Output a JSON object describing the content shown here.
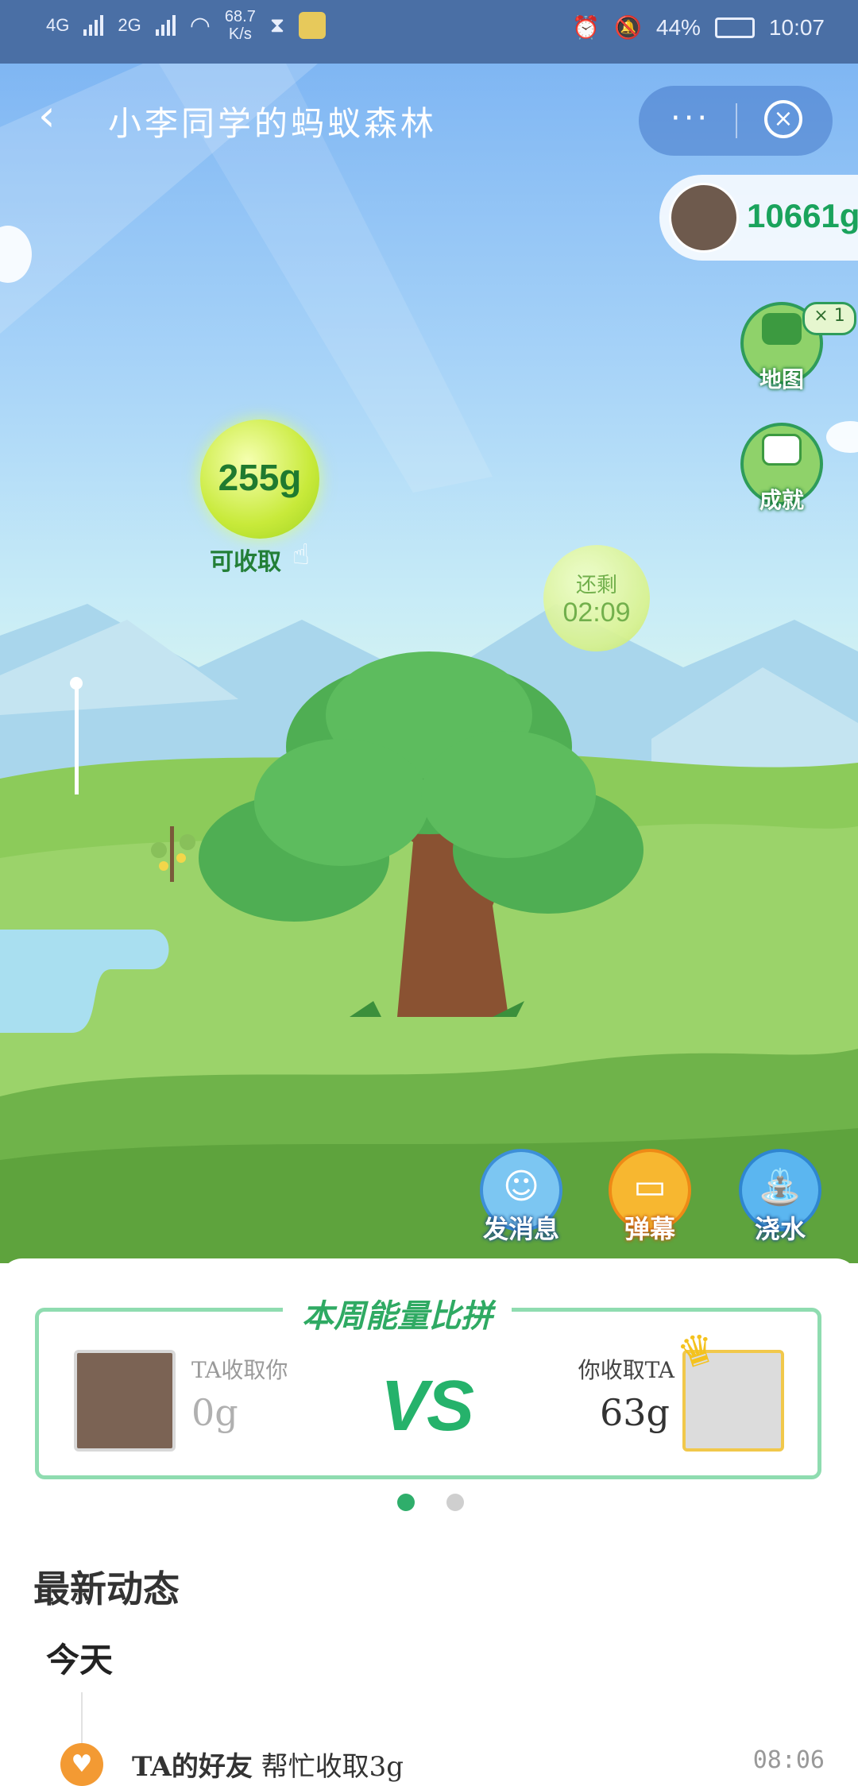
{
  "status_bar": {
    "net_left": "4G",
    "net_right": "2G",
    "speed_value": "68.7",
    "speed_unit": "K/s",
    "battery": "44%",
    "time": "10:07"
  },
  "header": {
    "title": "小李同学的蚂蚁森林",
    "more_label": "···"
  },
  "energy_total": "10661g",
  "side_buttons": {
    "map_label": "地图",
    "map_badge": "× 1",
    "achievement_label": "成就"
  },
  "bubbles": {
    "ripe_value": "255g",
    "ripe_hint": "可收取",
    "pending_label": "还剩",
    "pending_time": "02:09"
  },
  "actions": {
    "message_label": "发消息",
    "barrage_label": "弹幕",
    "water_label": "浇水"
  },
  "pk": {
    "title": "本周能量比拼",
    "left_label": "TA收取你",
    "left_value": "0g",
    "vs": "VS",
    "right_label": "你收取TA",
    "right_value": "63g"
  },
  "feed": {
    "section_title": "最新动态",
    "day": "今天",
    "items": [
      {
        "actor": "TA的好友",
        "action": "帮忙收取3g",
        "time": "08:06"
      }
    ]
  },
  "colors": {
    "accent_green": "#2fae6b",
    "status_bar": "#4a6fa5"
  }
}
